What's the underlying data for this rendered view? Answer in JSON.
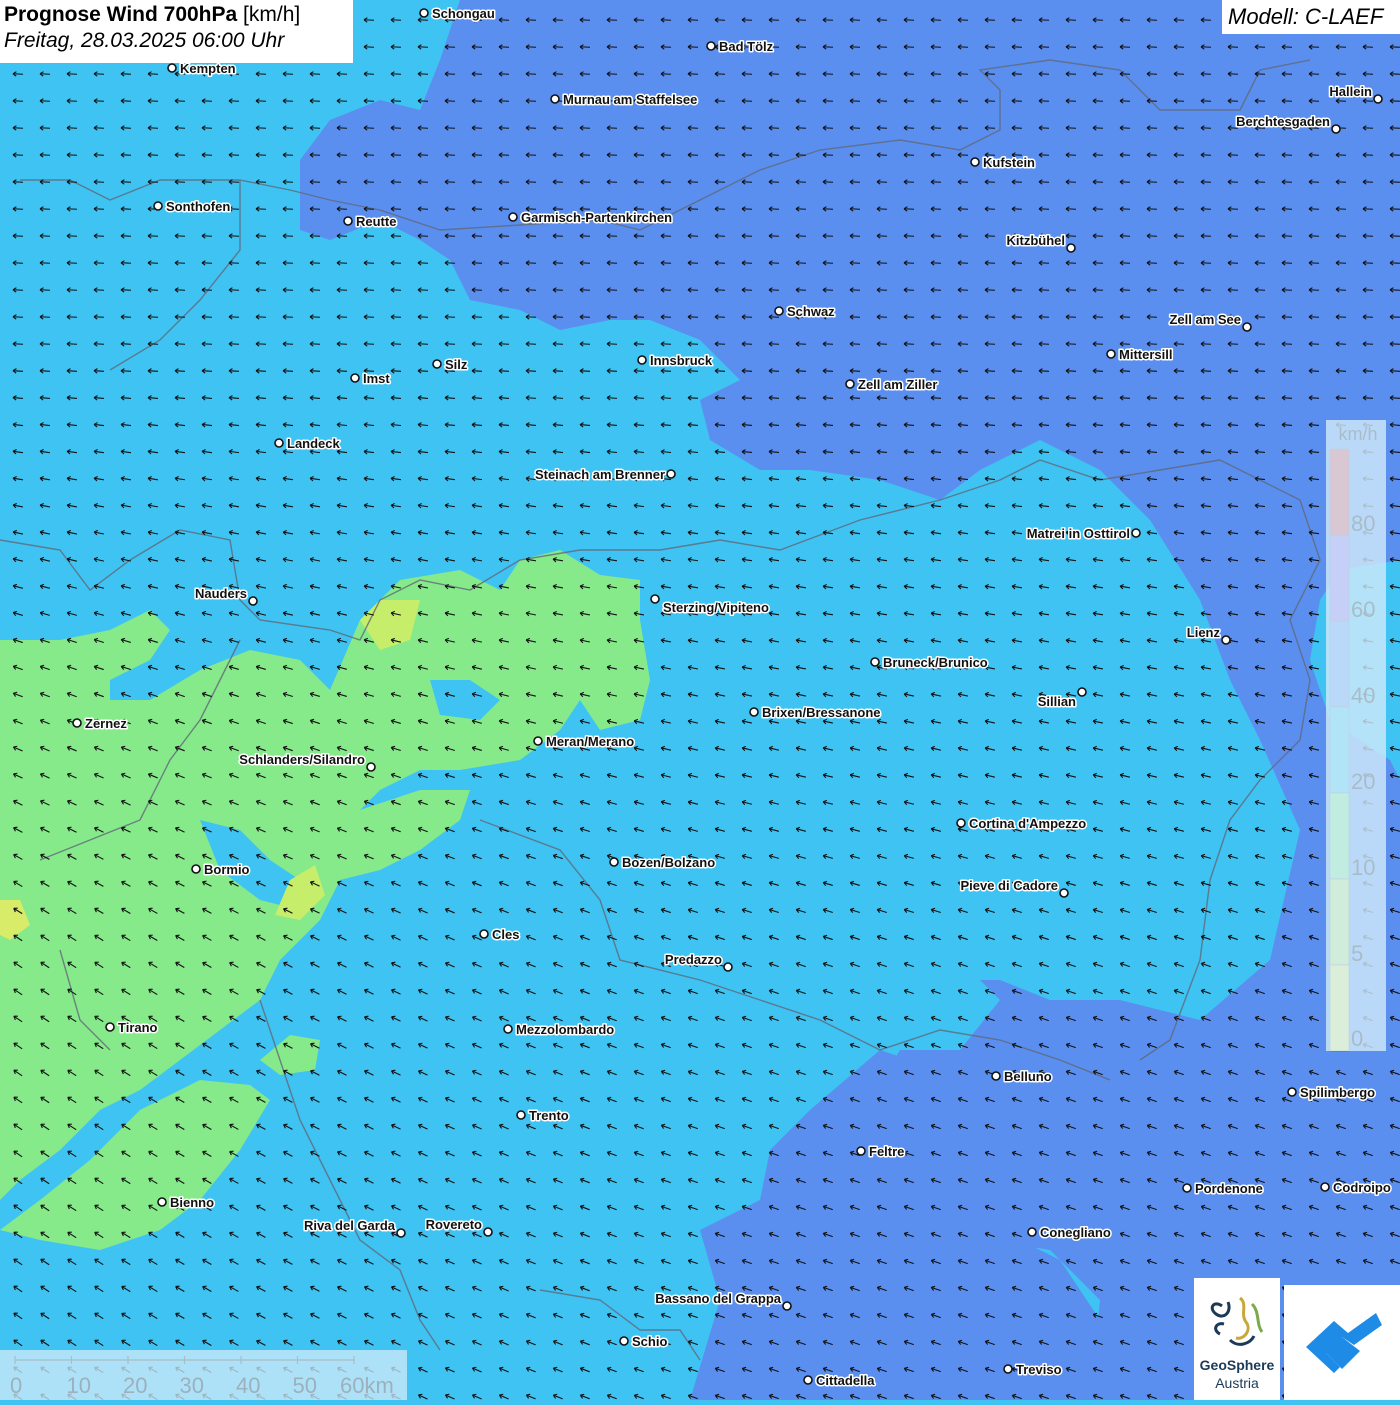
{
  "header": {
    "title_bold": "Prognose Wind 700hPa",
    "title_unit": "[km/h]",
    "subtitle": "Freitag, 28.03.2025 06:00 Uhr",
    "model": "Modell: C-LAEF"
  },
  "legend": {
    "unit": "km/h",
    "ticks": [
      "0",
      "5",
      "10",
      "20",
      "40",
      "60",
      "80"
    ],
    "colors": [
      "#f7f75a",
      "#c8f05a",
      "#7ef07a",
      "#35c9f0",
      "#5b8cf2",
      "#8f5ee8",
      "#f23b3b"
    ]
  },
  "scalebar": {
    "labels": [
      "0",
      "10",
      "20",
      "30",
      "40",
      "50",
      "60km"
    ]
  },
  "wind": {
    "direction": "from northeast",
    "dominant_color": "#3fc3f3"
  },
  "cities": [
    {
      "name": "Schongau"
    },
    {
      "name": "Bad Tölz"
    },
    {
      "name": "Kempten"
    },
    {
      "name": "Murnau am Staffelsee"
    },
    {
      "name": "Hallein"
    },
    {
      "name": "Berchtesgaden"
    },
    {
      "name": "Kufstein"
    },
    {
      "name": "Sonthofen"
    },
    {
      "name": "Reutte"
    },
    {
      "name": "Garmisch-Partenkirchen"
    },
    {
      "name": "Kitzbühel"
    },
    {
      "name": "Schwaz"
    },
    {
      "name": "Zell am See"
    },
    {
      "name": "Mittersill"
    },
    {
      "name": "Silz"
    },
    {
      "name": "Innsbruck"
    },
    {
      "name": "Imst"
    },
    {
      "name": "Zell am Ziller"
    },
    {
      "name": "Landeck"
    },
    {
      "name": "Steinach am Brenner"
    },
    {
      "name": "Matrei in Osttirol"
    },
    {
      "name": "Nauders"
    },
    {
      "name": "Sterzing/Vipiteno"
    },
    {
      "name": "Lienz"
    },
    {
      "name": "Bruneck/Brunico"
    },
    {
      "name": "Sillian"
    },
    {
      "name": "Brixen/Bressanone"
    },
    {
      "name": "Zernez"
    },
    {
      "name": "Meran/Merano"
    },
    {
      "name": "Schlanders/Silandro"
    },
    {
      "name": "Cortina d'Ampezzo"
    },
    {
      "name": "Bozen/Bolzano"
    },
    {
      "name": "Bormio"
    },
    {
      "name": "Pieve di Cadore"
    },
    {
      "name": "Cles"
    },
    {
      "name": "Predazzo"
    },
    {
      "name": "Tirano"
    },
    {
      "name": "Mezzolombardo"
    },
    {
      "name": "Belluno"
    },
    {
      "name": "Spilimbergo"
    },
    {
      "name": "Trento"
    },
    {
      "name": "Feltre"
    },
    {
      "name": "Pordenone"
    },
    {
      "name": "Codroipo"
    },
    {
      "name": "Bienno"
    },
    {
      "name": "Riva del Garda"
    },
    {
      "name": "Rovereto"
    },
    {
      "name": "Conegliano"
    },
    {
      "name": "Bassano del Grappa"
    },
    {
      "name": "Schio"
    },
    {
      "name": "Treviso"
    },
    {
      "name": "Cittadella"
    }
  ],
  "logos": {
    "geosphere_line1": "GeoSphere",
    "geosphere_line2": "Austria"
  }
}
